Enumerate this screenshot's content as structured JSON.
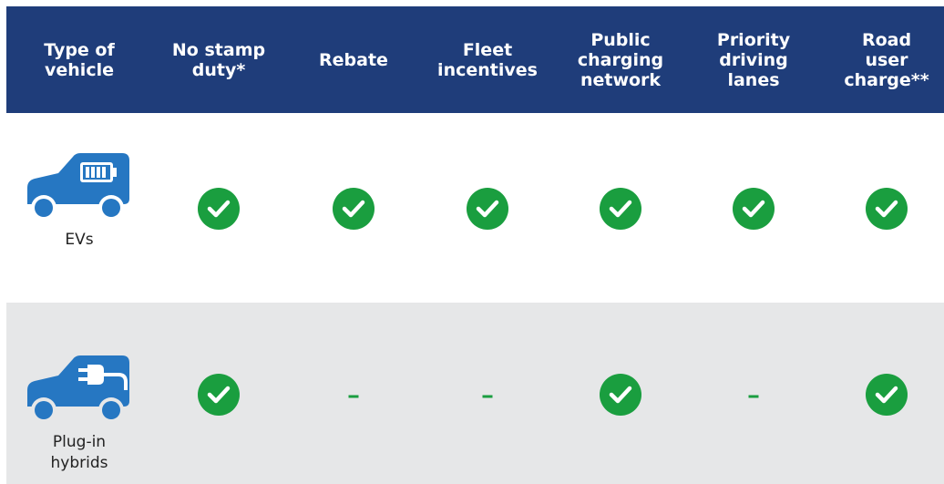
{
  "colors": {
    "header_bg": "#1f3d7a",
    "check": "#1a9e3f",
    "icon": "#2677c2",
    "alt_row": "#e6e7e8"
  },
  "headers": [
    "Type of\nvehicle",
    "No stamp\nduty*",
    "Rebate",
    "Fleet\nincentives",
    "Public\ncharging\nnetwork",
    "Priority\ndriving\nlanes",
    "Road user\ncharge**"
  ],
  "rows": [
    {
      "label": "EVs",
      "icon": "battery-car-icon",
      "cells": [
        "check",
        "check",
        "check",
        "check",
        "check",
        "check"
      ]
    },
    {
      "label": "Plug-in\nhybrids",
      "icon": "plug-car-icon",
      "cells": [
        "check",
        "-",
        "-",
        "check",
        "-",
        "check"
      ]
    }
  ]
}
